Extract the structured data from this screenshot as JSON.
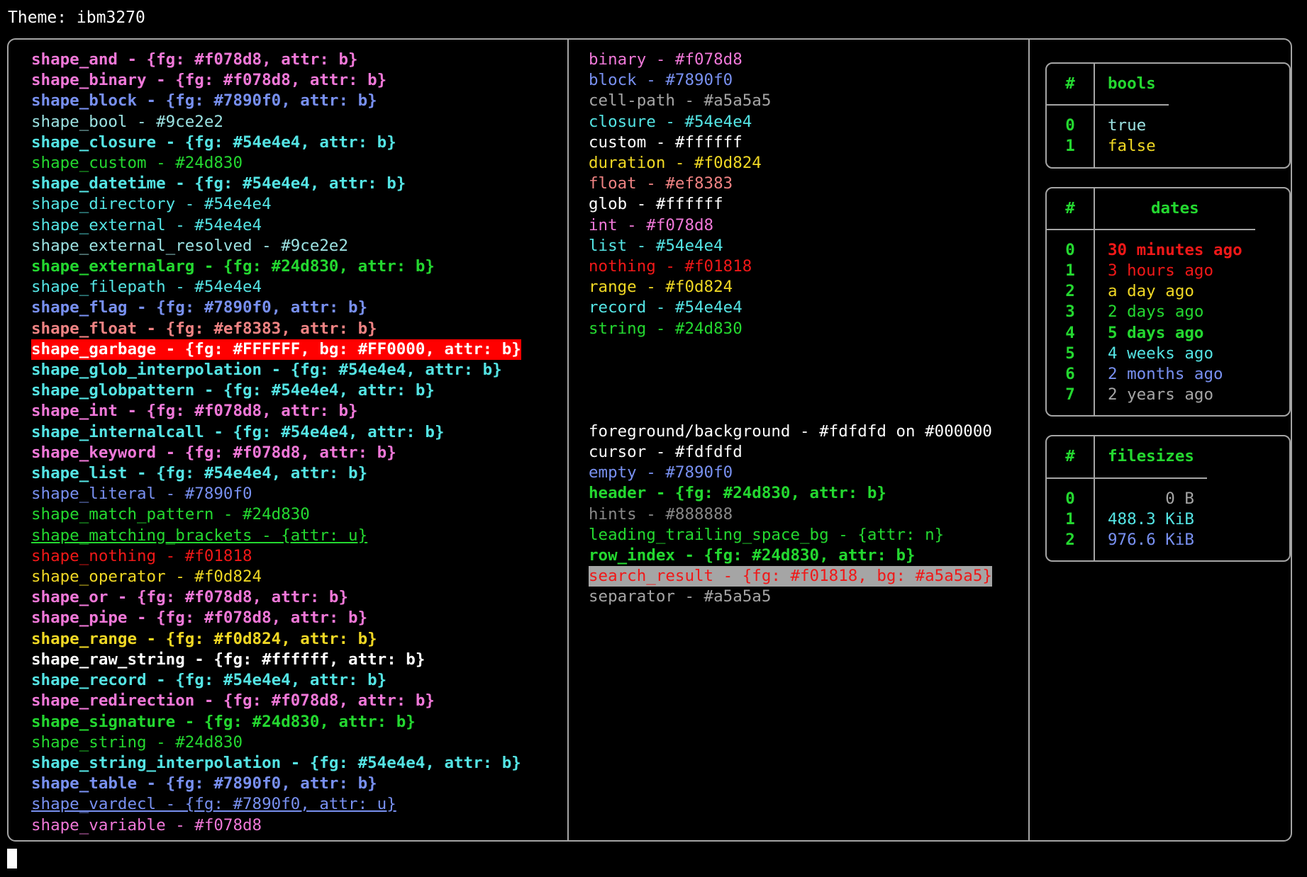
{
  "header": {
    "label": "Theme:",
    "theme_name": "ibm3270",
    "full": "Theme: ibm3270"
  },
  "palette": {
    "background": "#000000",
    "foreground": "#fdfdfd",
    "border": "#a5a5a5",
    "pink": "#f078d8",
    "blue": "#7890f0",
    "cyan_light": "#9ce2e2",
    "cyan": "#54e4e4",
    "green": "#24d830",
    "red": "#f01818",
    "yellow": "#f0d824",
    "salmon": "#ef8383",
    "white": "#ffffff",
    "gray": "#a5a5a5",
    "hint_gray": "#888888",
    "garbage_fg": "#FFFFFF",
    "garbage_bg": "#FF0000",
    "search_bg": "#a5a5a5"
  },
  "shapes_pane": {
    "lines": [
      {
        "text": "shape_and - {fg: #f078d8, attr: b}",
        "fg": "#f078d8",
        "bold": true
      },
      {
        "text": "shape_binary - {fg: #f078d8, attr: b}",
        "fg": "#f078d8",
        "bold": true
      },
      {
        "text": "shape_block - {fg: #7890f0, attr: b}",
        "fg": "#7890f0",
        "bold": true
      },
      {
        "text": "shape_bool - #9ce2e2",
        "fg": "#9ce2e2",
        "bold": false
      },
      {
        "text": "shape_closure - {fg: #54e4e4, attr: b}",
        "fg": "#54e4e4",
        "bold": true
      },
      {
        "text": "shape_custom - #24d830",
        "fg": "#24d830",
        "bold": false
      },
      {
        "text": "shape_datetime - {fg: #54e4e4, attr: b}",
        "fg": "#54e4e4",
        "bold": true
      },
      {
        "text": "shape_directory - #54e4e4",
        "fg": "#54e4e4",
        "bold": false
      },
      {
        "text": "shape_external - #54e4e4",
        "fg": "#54e4e4",
        "bold": false
      },
      {
        "text": "shape_external_resolved - #9ce2e2",
        "fg": "#9ce2e2",
        "bold": false
      },
      {
        "text": "shape_externalarg - {fg: #24d830, attr: b}",
        "fg": "#24d830",
        "bold": true
      },
      {
        "text": "shape_filepath - #54e4e4",
        "fg": "#54e4e4",
        "bold": false
      },
      {
        "text": "shape_flag - {fg: #7890f0, attr: b}",
        "fg": "#7890f0",
        "bold": true
      },
      {
        "text": "shape_float - {fg: #ef8383, attr: b}",
        "fg": "#ef8383",
        "bold": true
      },
      {
        "text": "shape_garbage - {fg: #FFFFFF, bg: #FF0000, attr: b}",
        "fg": "#FFFFFF",
        "bg": "#FF0000",
        "bold": true
      },
      {
        "text": "shape_glob_interpolation - {fg: #54e4e4, attr: b}",
        "fg": "#54e4e4",
        "bold": true
      },
      {
        "text": "shape_globpattern - {fg: #54e4e4, attr: b}",
        "fg": "#54e4e4",
        "bold": true
      },
      {
        "text": "shape_int - {fg: #f078d8, attr: b}",
        "fg": "#f078d8",
        "bold": true
      },
      {
        "text": "shape_internalcall - {fg: #54e4e4, attr: b}",
        "fg": "#54e4e4",
        "bold": true
      },
      {
        "text": "shape_keyword - {fg: #f078d8, attr: b}",
        "fg": "#f078d8",
        "bold": true
      },
      {
        "text": "shape_list - {fg: #54e4e4, attr: b}",
        "fg": "#54e4e4",
        "bold": true
      },
      {
        "text": "shape_literal - #7890f0",
        "fg": "#7890f0",
        "bold": false
      },
      {
        "text": "shape_match_pattern - #24d830",
        "fg": "#24d830",
        "bold": false
      },
      {
        "text": "shape_matching_brackets - {attr: u}",
        "fg": "#24d830",
        "bold": false,
        "underline": true
      },
      {
        "text": "shape_nothing - #f01818",
        "fg": "#f01818",
        "bold": false
      },
      {
        "text": "shape_operator - #f0d824",
        "fg": "#f0d824",
        "bold": false
      },
      {
        "text": "shape_or - {fg: #f078d8, attr: b}",
        "fg": "#f078d8",
        "bold": true
      },
      {
        "text": "shape_pipe - {fg: #f078d8, attr: b}",
        "fg": "#f078d8",
        "bold": true
      },
      {
        "text": "shape_range - {fg: #f0d824, attr: b}",
        "fg": "#f0d824",
        "bold": true
      },
      {
        "text": "shape_raw_string - {fg: #ffffff, attr: b}",
        "fg": "#ffffff",
        "bold": true
      },
      {
        "text": "shape_record - {fg: #54e4e4, attr: b}",
        "fg": "#54e4e4",
        "bold": true
      },
      {
        "text": "shape_redirection - {fg: #f078d8, attr: b}",
        "fg": "#f078d8",
        "bold": true
      },
      {
        "text": "shape_signature - {fg: #24d830, attr: b}",
        "fg": "#24d830",
        "bold": true
      },
      {
        "text": "shape_string - #24d830",
        "fg": "#24d830",
        "bold": false
      },
      {
        "text": "shape_string_interpolation - {fg: #54e4e4, attr: b}",
        "fg": "#54e4e4",
        "bold": true
      },
      {
        "text": "shape_table - {fg: #7890f0, attr: b}",
        "fg": "#7890f0",
        "bold": true
      },
      {
        "text": "shape_vardecl - {fg: #7890f0, attr: u}",
        "fg": "#7890f0",
        "bold": false,
        "underline": true
      },
      {
        "text": "shape_variable - #f078d8",
        "fg": "#f078d8",
        "bold": false
      }
    ]
  },
  "primitives_pane": {
    "lines": [
      {
        "text": "binary - #f078d8",
        "fg": "#f078d8",
        "bold": false
      },
      {
        "text": "block - #7890f0",
        "fg": "#7890f0",
        "bold": false
      },
      {
        "text": "cell-path - #a5a5a5",
        "fg": "#a5a5a5",
        "bold": false
      },
      {
        "text": "closure - #54e4e4",
        "fg": "#54e4e4",
        "bold": false
      },
      {
        "text": "custom - #ffffff",
        "fg": "#ffffff",
        "bold": false
      },
      {
        "text": "duration - #f0d824",
        "fg": "#f0d824",
        "bold": false
      },
      {
        "text": "float - #ef8383",
        "fg": "#ef8383",
        "bold": false
      },
      {
        "text": "glob - #ffffff",
        "fg": "#ffffff",
        "bold": false
      },
      {
        "text": "int - #f078d8",
        "fg": "#f078d8",
        "bold": false
      },
      {
        "text": "list - #54e4e4",
        "fg": "#54e4e4",
        "bold": false
      },
      {
        "text": "nothing - #f01818",
        "fg": "#f01818",
        "bold": false
      },
      {
        "text": "range - #f0d824",
        "fg": "#f0d824",
        "bold": false
      },
      {
        "text": "record - #54e4e4",
        "fg": "#54e4e4",
        "bold": false
      },
      {
        "text": "string - #24d830",
        "fg": "#24d830",
        "bold": false
      }
    ],
    "ui_lines": [
      {
        "text": "foreground/background - #fdfdfd on #000000",
        "fg": "#fdfdfd",
        "bold": false
      },
      {
        "text": "cursor - #fdfdfd",
        "fg": "#fdfdfd",
        "bold": false
      },
      {
        "text": "empty - #7890f0",
        "fg": "#7890f0",
        "bold": false
      },
      {
        "text": "header - {fg: #24d830, attr: b}",
        "fg": "#24d830",
        "bold": true
      },
      {
        "text": "hints - #888888",
        "fg": "#888888",
        "bold": false
      },
      {
        "text": "leading_trailing_space_bg - {attr: n}",
        "fg": "#24d830",
        "bold": false
      },
      {
        "text": "row_index - {fg: #24d830, attr: b}",
        "fg": "#24d830",
        "bold": true
      },
      {
        "text": "search_result - {fg: #f01818, bg: #a5a5a5}",
        "fg": "#f01818",
        "bg": "#a5a5a5",
        "bold": false
      },
      {
        "text": "separator - #a5a5a5",
        "fg": "#a5a5a5",
        "bold": false
      }
    ]
  },
  "tables": [
    {
      "name": "bools",
      "headers": [
        "#",
        "bools"
      ],
      "align": "left",
      "rows": [
        {
          "index": "0",
          "value": "true",
          "fg": "#9ce2e2",
          "bold": false
        },
        {
          "index": "1",
          "value": "false",
          "fg": "#f0d824",
          "bold": false
        }
      ]
    },
    {
      "name": "dates",
      "headers": [
        "#",
        "dates"
      ],
      "align": "left",
      "rows": [
        {
          "index": "0",
          "value": "30 minutes ago",
          "fg": "#f01818",
          "bold": true
        },
        {
          "index": "1",
          "value": "3 hours ago",
          "fg": "#f01818",
          "bold": false
        },
        {
          "index": "2",
          "value": "a day ago",
          "fg": "#f0d824",
          "bold": false
        },
        {
          "index": "3",
          "value": "2 days ago",
          "fg": "#24d830",
          "bold": false
        },
        {
          "index": "4",
          "value": "5 days ago",
          "fg": "#24d830",
          "bold": true
        },
        {
          "index": "5",
          "value": "4 weeks ago",
          "fg": "#54e4e4",
          "bold": false
        },
        {
          "index": "6",
          "value": "2 months ago",
          "fg": "#7890f0",
          "bold": false
        },
        {
          "index": "7",
          "value": "2 years ago",
          "fg": "#a5a5a5",
          "bold": false
        }
      ]
    },
    {
      "name": "filesizes",
      "headers": [
        "#",
        "filesizes"
      ],
      "align": "right",
      "rows": [
        {
          "index": "0",
          "value": "0 B",
          "fg": "#a5a5a5",
          "bold": false
        },
        {
          "index": "1",
          "value": "488.3 KiB",
          "fg": "#54e4e4",
          "bold": false
        },
        {
          "index": "2",
          "value": "976.6 KiB",
          "fg": "#7890f0",
          "bold": false
        }
      ]
    }
  ],
  "cursor": {
    "visible": true
  }
}
